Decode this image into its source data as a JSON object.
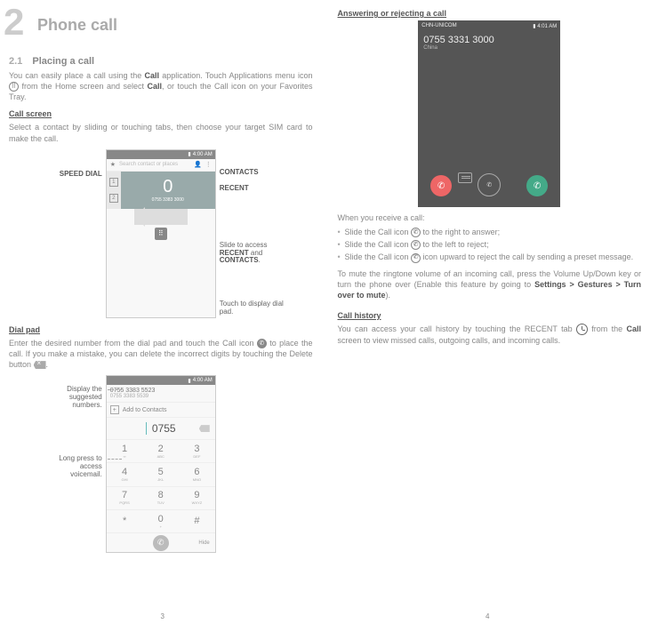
{
  "left": {
    "chapter_num": "2",
    "chapter_title": "Phone call",
    "section_num": "2.1",
    "section_name": "Placing a call",
    "intro": "You can easily place a call using the ",
    "intro_b1": "Call",
    "intro2": " application. Touch Applications menu icon ",
    "intro3": " from the Home screen and select ",
    "intro_b2": "Call",
    "intro4": ", or touch the Call icon on your Favorites Tray.",
    "h_callscreen": "Call screen",
    "p_callscreen": "Select a contact by sliding or touching tabs, then choose your target SIM card to make the call.",
    "labels": {
      "speed_dial": "SPEED DIAL",
      "contacts": "CONTACTS",
      "recent": "RECENT",
      "slide": "Slide to access RECENT and CONTACTS.",
      "dialpad": "Touch to display dial pad."
    },
    "mock1": {
      "time": "4:00 AM",
      "search": "Search contact or places",
      "sim1": "1",
      "sim2": "2",
      "zero": "0",
      "number": "0755 3383 3000"
    },
    "h_dialpad": "Dial pad",
    "p_dialpad1": "Enter the desired number from the dial pad and touch the Call icon ",
    "p_dialpad2": " to place the call. If you make a mistake, you can delete the incorrect digits by touching the Delete button ",
    "p_dialpad3": ".",
    "labels2": {
      "suggest": "Display the suggested numbers.",
      "voicemail": "Long press to access voicemail."
    },
    "mock2": {
      "time": "4:00 AM",
      "sug1": "0755 3383 5523",
      "sug2": "0755 3383 5539",
      "add": "Add to Contacts",
      "entered": "0755",
      "keys": [
        {
          "n": "1",
          "l": "∞"
        },
        {
          "n": "2",
          "l": "ABC"
        },
        {
          "n": "3",
          "l": "DEF"
        },
        {
          "n": "4",
          "l": "GHI"
        },
        {
          "n": "5",
          "l": "JKL"
        },
        {
          "n": "6",
          "l": "MNO"
        },
        {
          "n": "7",
          "l": "PQRS"
        },
        {
          "n": "8",
          "l": "TUV"
        },
        {
          "n": "9",
          "l": "WXYZ"
        },
        {
          "n": "*",
          "l": ""
        },
        {
          "n": "0",
          "l": "+"
        },
        {
          "n": "#",
          "l": ""
        }
      ],
      "hide": "Hide"
    },
    "page_num": "3"
  },
  "right": {
    "h_answer": "Answering or rejecting a call",
    "mock3": {
      "carrier": "CHN-UNICOM",
      "time": "4:01 AM",
      "number": "0755 3331 3000",
      "sub": "China"
    },
    "p_receive": "When you receive a call:",
    "bullets": [
      {
        "pre": "Slide the Call icon ",
        "post": " to the right to answer;"
      },
      {
        "pre": "Slide the Call icon ",
        "post": " to the left to reject;"
      },
      {
        "pre": "Slide the Call icon ",
        "post": " icon upward to reject the call by sending a preset message."
      }
    ],
    "p_mute1": "To mute the ringtone volume of an incoming call, press the Volume Up/Down key or turn the phone over (Enable this feature by going to ",
    "p_mute_b": "Settings > Gestures > Turn over to mute",
    "p_mute2": ").",
    "h_history": "Call history",
    "p_history1": "You can access your call history by touching the RECENT tab ",
    "p_history2": " from the ",
    "p_history_b": "Call",
    "p_history3": " screen to view missed calls, outgoing calls, and incoming calls.",
    "page_num": "4"
  }
}
